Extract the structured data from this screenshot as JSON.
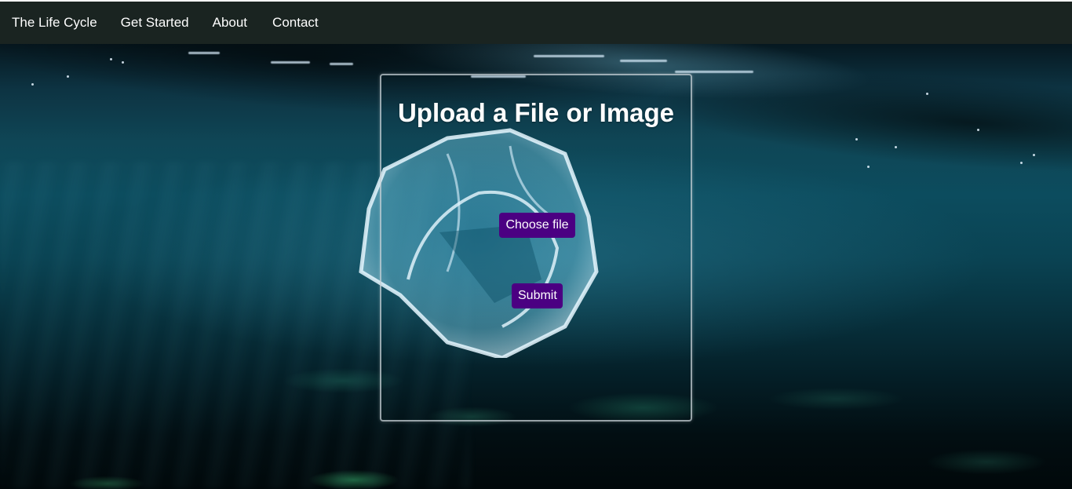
{
  "nav": {
    "items": [
      {
        "label": "The Life Cycle"
      },
      {
        "label": "Get Started"
      },
      {
        "label": "About"
      },
      {
        "label": "Contact"
      }
    ]
  },
  "upload": {
    "title": "Upload a File or Image",
    "choose_label": "Choose file",
    "submit_label": "Submit"
  },
  "colors": {
    "nav_background": "#1a2421",
    "button_background": "#4b0082",
    "text": "#ffffff"
  }
}
